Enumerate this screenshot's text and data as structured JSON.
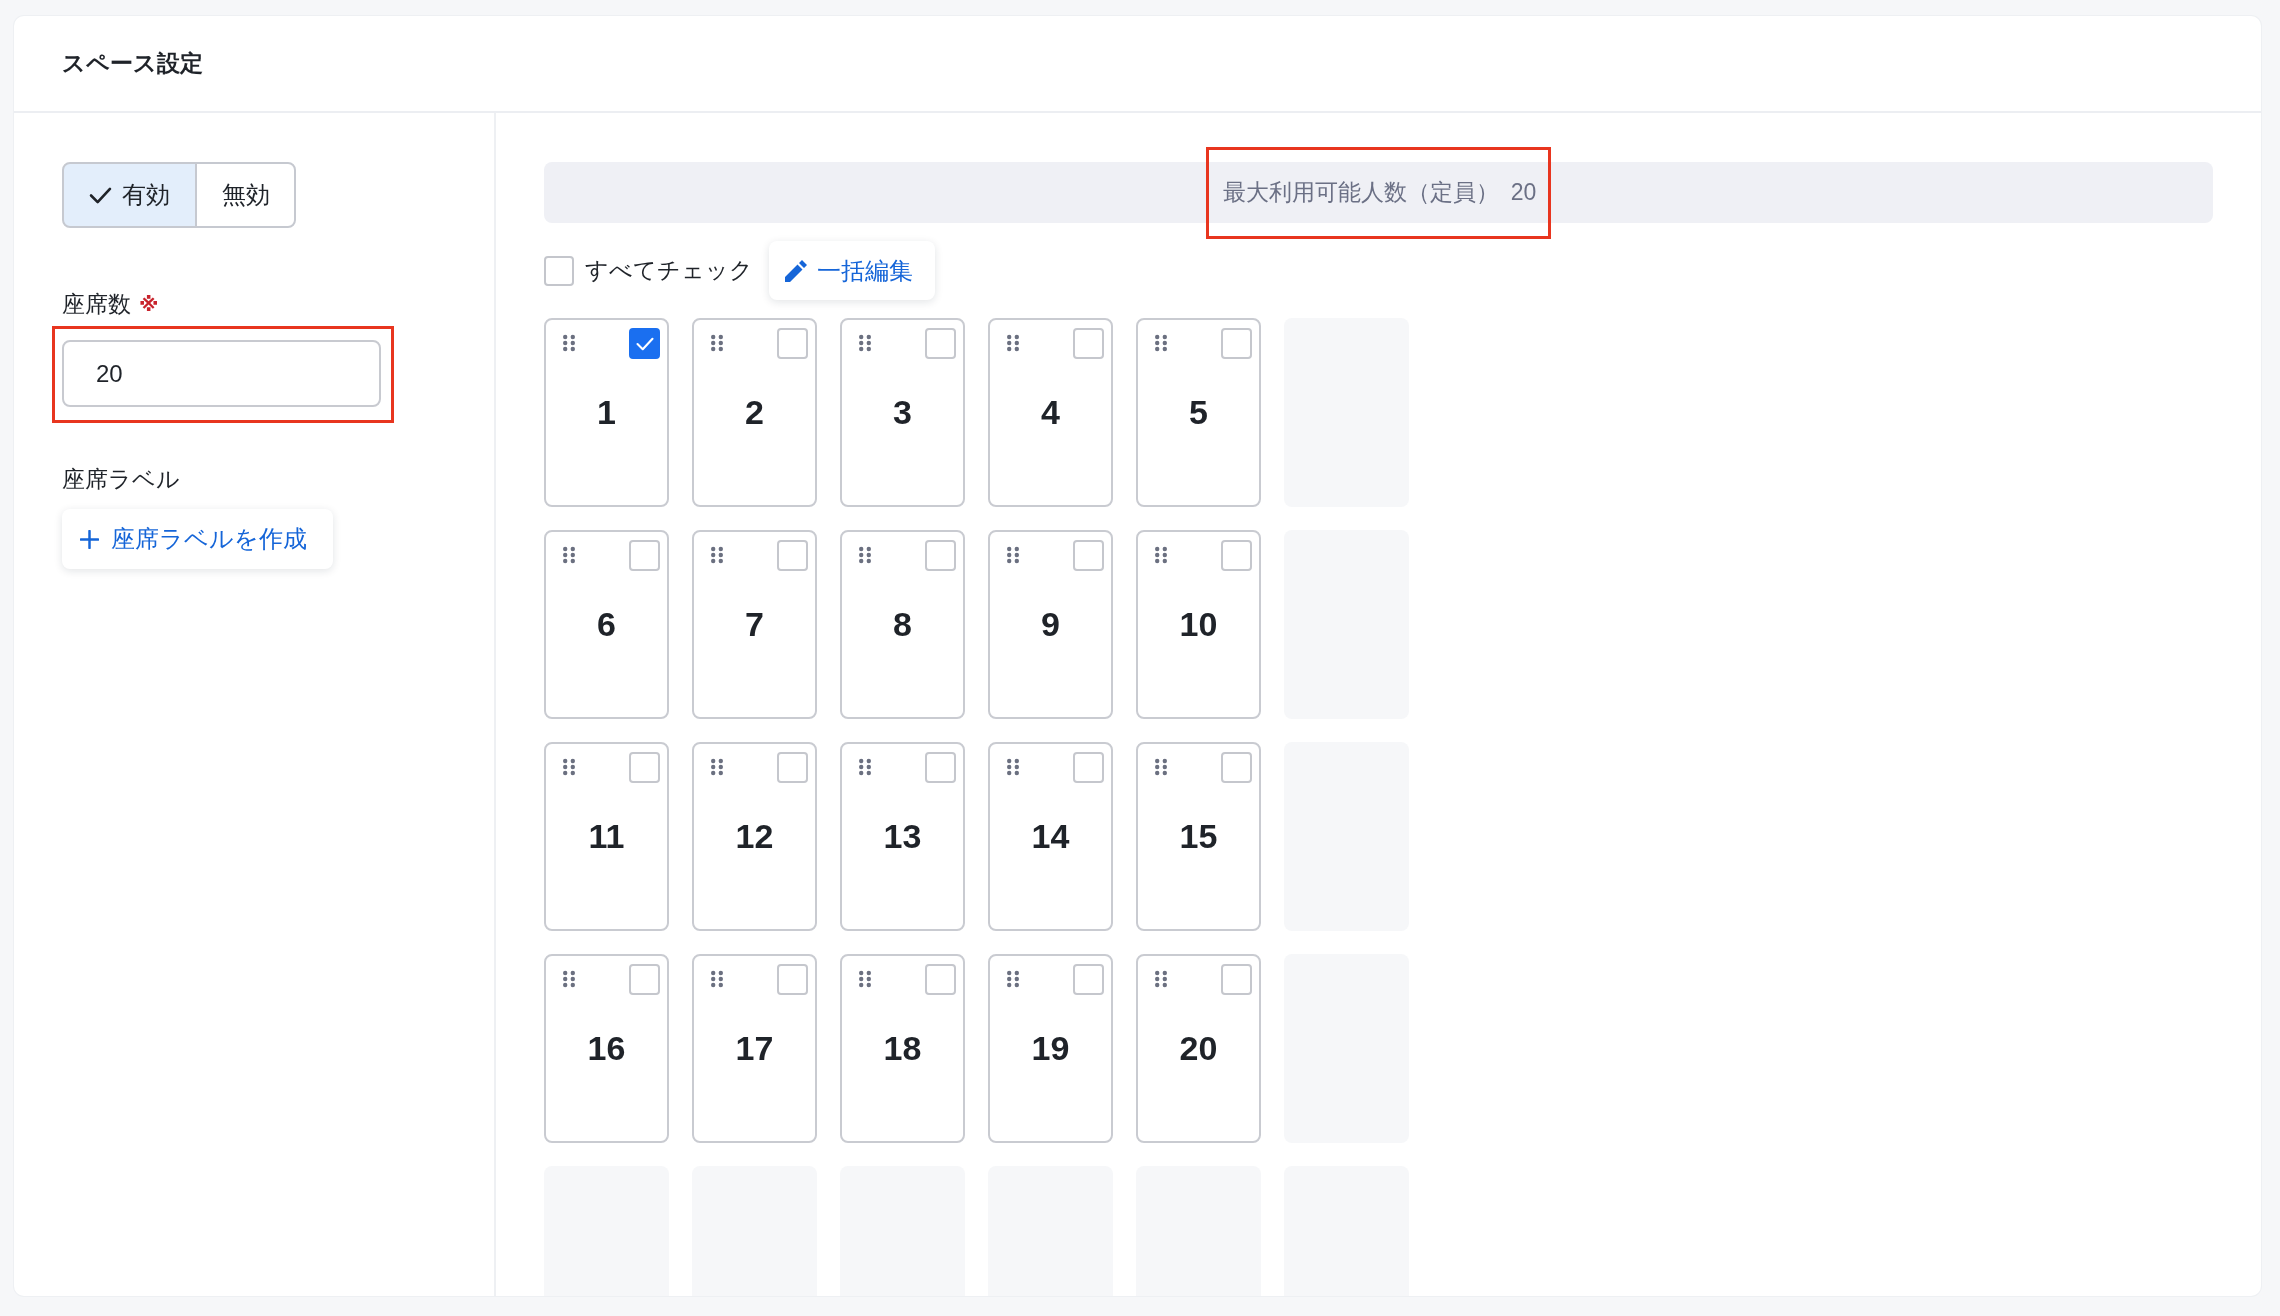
{
  "header": {
    "title": "スペース設定"
  },
  "status_toggle": [
    {
      "label": "有効",
      "selected": true
    },
    {
      "label": "無効",
      "selected": false
    }
  ],
  "seat_count": {
    "label": "座席数",
    "required_mark": "※",
    "value": "20",
    "highlighted": true
  },
  "seat_labels": {
    "label": "座席ラベル",
    "create_button": "座席ラベルを作成"
  },
  "capacity": {
    "label": "最大利用可能人数（定員）",
    "value": "20",
    "highlighted": true
  },
  "toolbar": {
    "check_all": {
      "label": "すべてチェック",
      "checked": false
    },
    "bulk_edit_button": "一括編集"
  },
  "seats": [
    {
      "number": "1",
      "checked": true
    },
    {
      "number": "2",
      "checked": false
    },
    {
      "number": "3",
      "checked": false
    },
    {
      "number": "4",
      "checked": false
    },
    {
      "number": "5",
      "checked": false
    },
    {
      "number": "6",
      "checked": false
    },
    {
      "number": "7",
      "checked": false
    },
    {
      "number": "8",
      "checked": false
    },
    {
      "number": "9",
      "checked": false
    },
    {
      "number": "10",
      "checked": false
    },
    {
      "number": "11",
      "checked": false
    },
    {
      "number": "12",
      "checked": false
    },
    {
      "number": "13",
      "checked": false
    },
    {
      "number": "14",
      "checked": false
    },
    {
      "number": "15",
      "checked": false
    },
    {
      "number": "16",
      "checked": false
    },
    {
      "number": "17",
      "checked": false
    },
    {
      "number": "18",
      "checked": false
    },
    {
      "number": "19",
      "checked": false
    },
    {
      "number": "20",
      "checked": false
    }
  ]
}
